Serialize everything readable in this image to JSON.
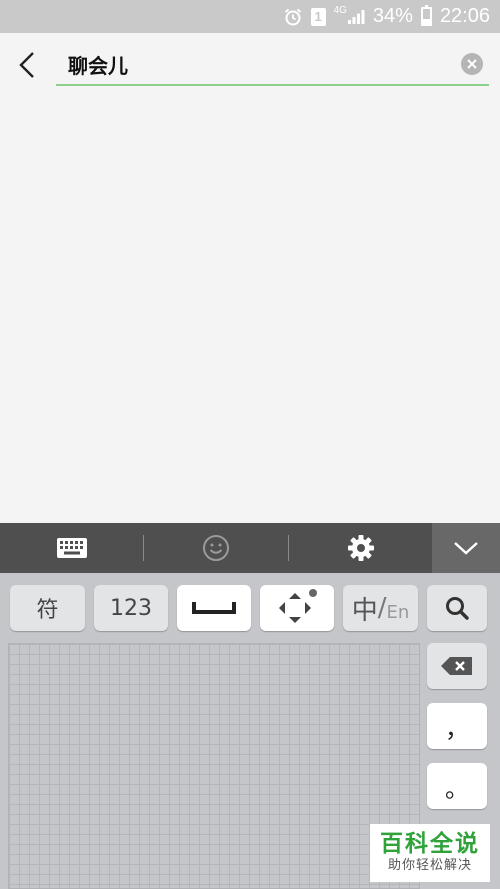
{
  "status_bar": {
    "sim_label": "1",
    "network": "4G",
    "battery": "34%",
    "battery_level": 0.34,
    "time": "22:06",
    "icons": [
      "alarm-icon",
      "sim-icon",
      "signal-icon",
      "battery-icon"
    ]
  },
  "search": {
    "value": "聊会儿",
    "placeholder": "",
    "accent_color": "#8dd18d"
  },
  "keyboard": {
    "toolbar_icons": [
      "keyboard-icon",
      "emoji-icon",
      "settings-icon",
      "chevron-down-icon"
    ],
    "keys": {
      "symbols": "符",
      "numbers": "123",
      "lang_main": "中",
      "lang_slash": "/",
      "lang_alt": "En",
      "comma": "，",
      "period": "。"
    }
  },
  "watermark": {
    "title": "百科全说",
    "subtitle": "助你轻松解决"
  }
}
